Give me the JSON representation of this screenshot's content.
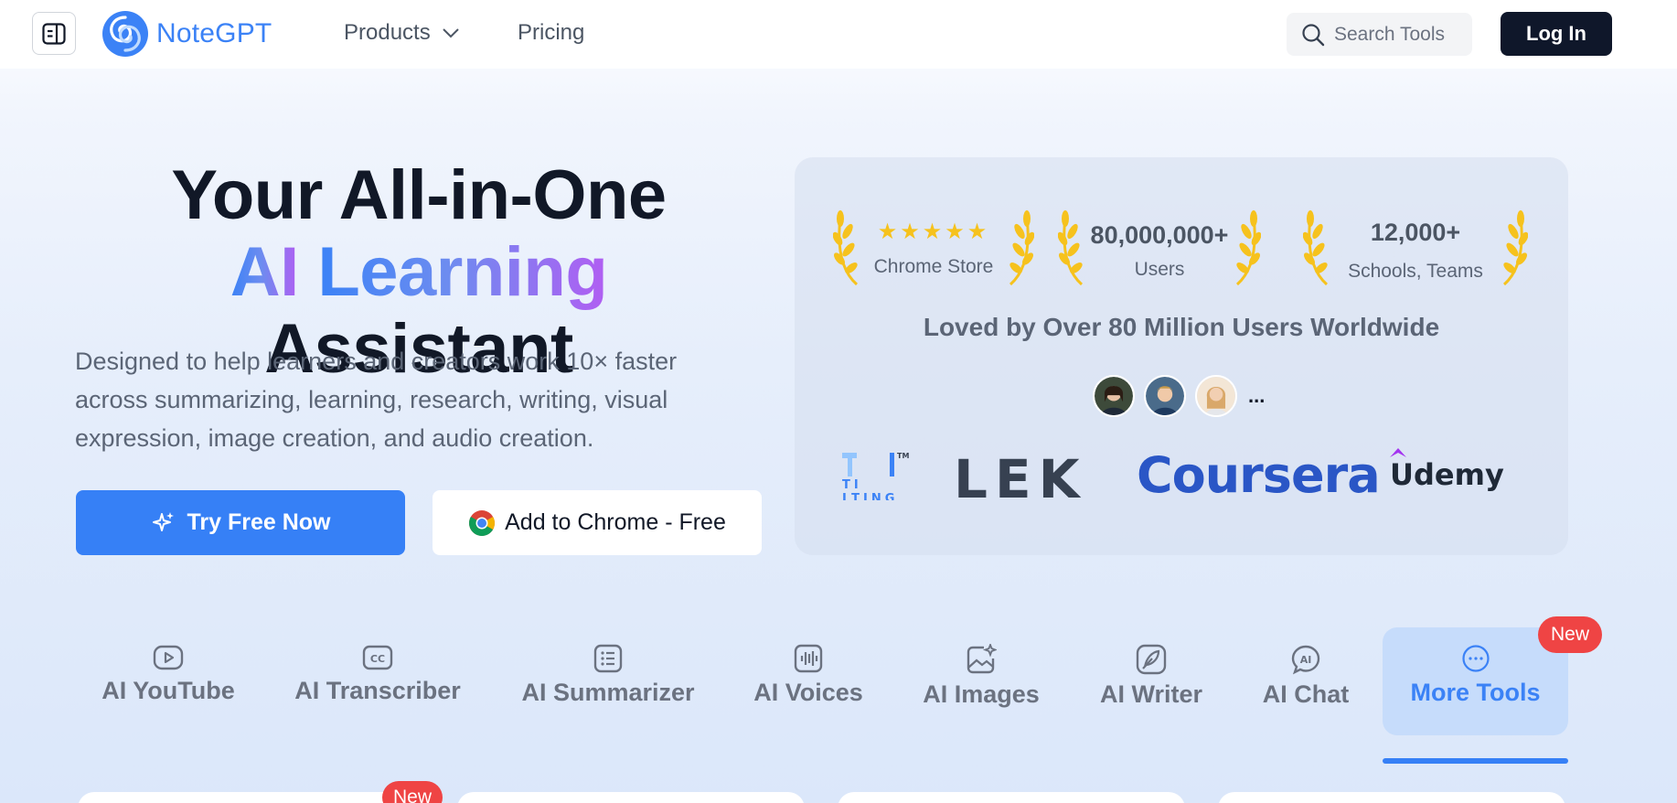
{
  "header": {
    "logo_text": "NoteGPT",
    "nav": {
      "products": "Products",
      "pricing": "Pricing"
    },
    "search_placeholder": "Search Tools",
    "login": "Log In"
  },
  "hero": {
    "title_line1": "Your All-in-One",
    "title_ai": "AI",
    "title_learning": "Learning",
    "title_assistant": "Assistant",
    "description": "Designed to help learners and creators work 10× faster across summarizing, learning, research, writing, visual expression, image creation, and audio creation.",
    "try_button": "Try Free Now",
    "chrome_button": "Add to Chrome - Free"
  },
  "stats": {
    "chrome_store": {
      "rating_stars": 5,
      "label": "Chrome Store"
    },
    "users": {
      "value": "80,000,000+",
      "label": "Users"
    },
    "schools": {
      "value": "12,000+",
      "label": "Schools, Teams"
    },
    "loved_text": "Loved by Over 80 Million Users Worldwide",
    "avatars_more": "...",
    "brands": [
      "TI LTING",
      "LEK",
      "Coursera",
      "Udemy"
    ]
  },
  "tabs": [
    {
      "label": "AI YouTube",
      "icon": "youtube-icon"
    },
    {
      "label": "AI Transcriber",
      "icon": "cc-icon"
    },
    {
      "label": "AI Summarizer",
      "icon": "list-icon"
    },
    {
      "label": "AI Voices",
      "icon": "waveform-icon"
    },
    {
      "label": "AI Images",
      "icon": "image-sparkle-icon"
    },
    {
      "label": "AI Writer",
      "icon": "feather-icon"
    },
    {
      "label": "AI Chat",
      "icon": "ai-chat-icon"
    },
    {
      "label": "More Tools",
      "icon": "more-icon",
      "active": true,
      "badge": "New"
    }
  ],
  "bottom_badge": "New",
  "colors": {
    "brand_blue": "#3b82f6",
    "button_blue": "#3680f6",
    "dark": "#0f172a",
    "badge_red": "#ef4444",
    "star_gold": "#f6c21d",
    "active_tab_bg": "#c6dcfb"
  }
}
